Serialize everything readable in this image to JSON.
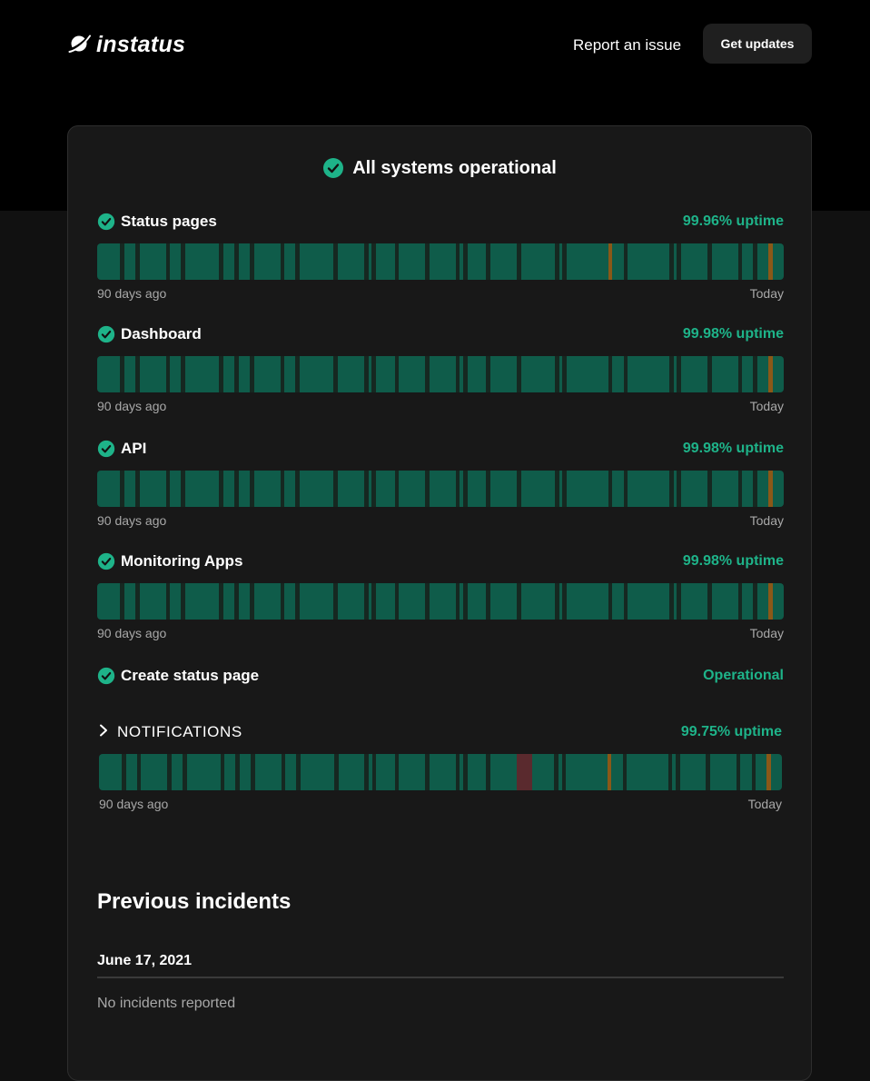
{
  "header": {
    "brand": "instatus",
    "report_link": "Report an issue",
    "updates_button": "Get updates"
  },
  "overall_status": "All systems operational",
  "colors": {
    "operational": "#1eb389",
    "bar_ok": "#0f5c4a",
    "bar_gap": "#162821",
    "bar_degraded": "#8a5818",
    "bar_outage": "#5a2a2e"
  },
  "components": [
    {
      "name": "Status pages",
      "status_text": "99.96% uptime",
      "range_start": "90 days ago",
      "range_end": "Today",
      "gap_days": [
        3,
        5,
        9,
        11,
        16,
        18,
        20,
        24,
        26,
        31,
        35,
        36,
        39,
        43,
        47,
        48,
        51,
        55,
        60,
        61,
        67,
        69,
        75,
        76,
        80,
        84,
        86,
        88
      ],
      "degraded_days": [
        67,
        88
      ],
      "outage_days": []
    },
    {
      "name": "Dashboard",
      "status_text": "99.98% uptime",
      "range_start": "90 days ago",
      "range_end": "Today",
      "gap_days": [
        3,
        5,
        9,
        11,
        16,
        18,
        20,
        24,
        26,
        31,
        35,
        36,
        39,
        43,
        47,
        48,
        51,
        55,
        60,
        61,
        67,
        69,
        75,
        76,
        80,
        84,
        86,
        88
      ],
      "degraded_days": [
        88
      ],
      "outage_days": []
    },
    {
      "name": "API",
      "status_text": "99.98% uptime",
      "range_start": "90 days ago",
      "range_end": "Today",
      "gap_days": [
        3,
        5,
        9,
        11,
        16,
        18,
        20,
        24,
        26,
        31,
        35,
        36,
        39,
        43,
        47,
        48,
        51,
        55,
        60,
        61,
        67,
        69,
        75,
        76,
        80,
        84,
        86,
        88
      ],
      "degraded_days": [
        88
      ],
      "outage_days": []
    },
    {
      "name": "Monitoring Apps",
      "status_text": "99.98% uptime",
      "range_start": "90 days ago",
      "range_end": "Today",
      "gap_days": [
        3,
        5,
        9,
        11,
        16,
        18,
        20,
        24,
        26,
        31,
        35,
        36,
        39,
        43,
        47,
        48,
        51,
        55,
        60,
        61,
        67,
        69,
        75,
        76,
        80,
        84,
        86,
        88
      ],
      "degraded_days": [
        88
      ],
      "outage_days": []
    }
  ],
  "simple_component": {
    "name": "Create status page",
    "status_text": "Operational"
  },
  "notifications": {
    "name": "NOTIFICATIONS",
    "status_text": "99.75% uptime",
    "range_start": "90 days ago",
    "range_end": "Today",
    "gap_days": [
      3,
      5,
      9,
      11,
      16,
      18,
      20,
      24,
      26,
      31,
      35,
      36,
      39,
      43,
      47,
      48,
      51,
      55,
      60,
      61,
      67,
      69,
      75,
      76,
      80,
      84,
      86,
      88
    ],
    "degraded_days": [
      67,
      88
    ],
    "outage_days": [
      55,
      56
    ]
  },
  "incidents": {
    "title": "Previous incidents",
    "groups": [
      {
        "date": "June 17, 2021",
        "text": "No incidents reported"
      }
    ]
  }
}
